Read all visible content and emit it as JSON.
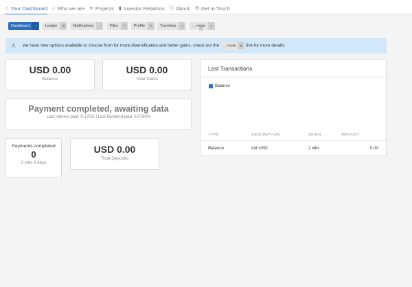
{
  "nav": {
    "items": [
      {
        "label": "Your Dashboard",
        "icon": "dashboard-icon",
        "glyph": "⌂"
      },
      {
        "label": "Who we are",
        "icon": "home-icon",
        "glyph": "⌂"
      },
      {
        "label": "Projects",
        "icon": "layers-icon",
        "glyph": "≋"
      },
      {
        "label": "Investor Relations",
        "icon": "chart-icon",
        "glyph": "▮"
      },
      {
        "label": "About",
        "icon": "info-icon",
        "glyph": "ⓘ"
      },
      {
        "label": "Get in Touch",
        "icon": "mail-icon",
        "glyph": "✉"
      }
    ]
  },
  "subnav": {
    "items": [
      {
        "label": "Dashboard",
        "glyph": "◔"
      },
      {
        "label": "Ledger",
        "glyph": "▤"
      },
      {
        "label": "Notifications",
        "glyph": "◌"
      },
      {
        "label": "Files",
        "glyph": "▢"
      },
      {
        "label": "Profile",
        "glyph": "♙"
      },
      {
        "label": "Transfers",
        "glyph": "▭"
      },
      {
        "label": "... more",
        "glyph": "↳"
      }
    ]
  },
  "banner": {
    "text_before": "we have new options available to choose from for more diversification and better gains, check out the",
    "pill_label": "... more",
    "pill_glyph": "↳",
    "text_after": "link for more details."
  },
  "cards": {
    "balance": {
      "value": "USD 0.00",
      "label": "Balance"
    },
    "total_gains": {
      "value": "USD 0.00",
      "label": "Total Gains"
    },
    "payment": {
      "title": "Payment completed, awaiting data",
      "info": "Last Interest paid: 0.175% | Last Dividend paid: 0.0760%"
    },
    "payments_completed": {
      "label": "Payments completed",
      "count": "0",
      "duration": "2 wks 3 days"
    },
    "total_deposits": {
      "value": "USD 0.00",
      "label": "Total Deposits"
    }
  },
  "transactions": {
    "title": "Last Transactions",
    "legend": "Balance",
    "legend_color": "#3a6fb5",
    "columns": [
      "TYPE",
      "DESCRIPTION",
      "WHEN",
      "AMOUNT"
    ],
    "rows": [
      {
        "type": "Balance",
        "description": "Init USD",
        "when": "2 wks",
        "amount": "0.00"
      }
    ]
  },
  "colors": {
    "accent": "#2f73c5",
    "banner_bg": "#d2e8f8"
  }
}
